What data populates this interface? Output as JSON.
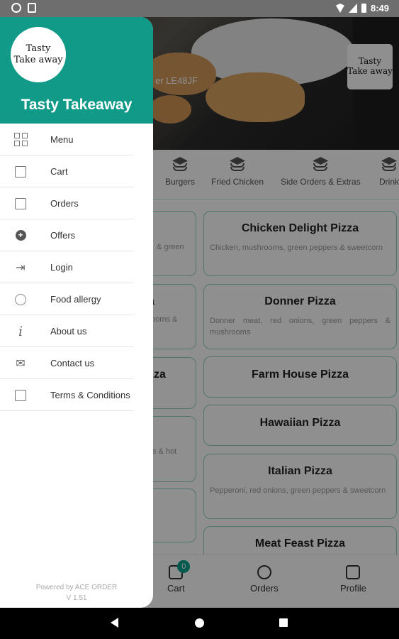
{
  "status_bar": {
    "time": "8:49"
  },
  "hero": {
    "postcode_fragment": "er LE48JF",
    "logo_line1": "Tasty",
    "logo_line2": "Take away"
  },
  "categories": [
    {
      "label": "Burgers",
      "icon": "layers-icon"
    },
    {
      "label": "Fried Chicken",
      "icon": "layers-icon"
    },
    {
      "label": "Side Orders & Extras",
      "icon": "layers-icon"
    },
    {
      "label": "Drink",
      "icon": "layers-icon"
    }
  ],
  "menu_cards": [
    {
      "title": "Chicken Delight Pizza",
      "desc": "Chicken, mushrooms, green peppers & sweetcorn"
    },
    {
      "title": "Donner Pizza",
      "desc": "Donner meat, red onions, green peppers & mushrooms"
    },
    {
      "title": "Farm House Pizza",
      "desc": ""
    },
    {
      "title": "Hawaiian Pizza",
      "desc": ""
    },
    {
      "title": "Italian Pizza",
      "desc": "Pepperoni, red onions, green peppers & sweetcorn"
    },
    {
      "title": "Meat Feast Pizza",
      "desc": ""
    }
  ],
  "left_fragments": {
    "desc1": "& green",
    "title2": "a",
    "desc2": "ooms &",
    "title3": "zza",
    "desc4": "s & hot"
  },
  "bottom_nav": {
    "cart_label": "Cart",
    "cart_count": "0",
    "orders_label": "Orders",
    "profile_label": "Profile"
  },
  "drawer": {
    "logo_line1": "Tasty",
    "logo_line2": "Take away",
    "title": "Tasty Takeaway",
    "items": [
      {
        "label": "Menu",
        "icon": "menu-grid-icon"
      },
      {
        "label": "Cart",
        "icon": "cart-icon"
      },
      {
        "label": "Orders",
        "icon": "orders-icon"
      },
      {
        "label": "Offers",
        "icon": "offers-icon"
      },
      {
        "label": "Login",
        "icon": "login-icon"
      },
      {
        "label": "Food allergy",
        "icon": "food-allergy-icon"
      },
      {
        "label": "About us",
        "icon": "info-icon"
      },
      {
        "label": "Contact us",
        "icon": "contact-icon"
      },
      {
        "label": "Terms & Conditions",
        "icon": "terms-icon"
      }
    ],
    "powered_by": "Powered by ACE ORDER",
    "version": "V 1.51"
  },
  "colors": {
    "brand": "#129a88",
    "card_border": "#8fd0c6",
    "badge": "#00a08a"
  }
}
